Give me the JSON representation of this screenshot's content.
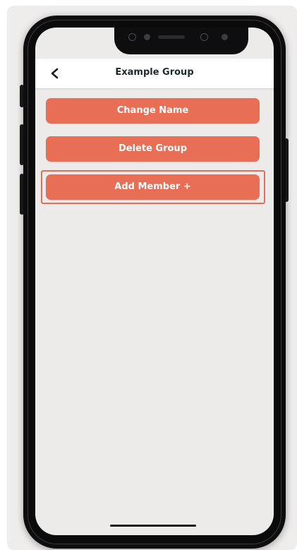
{
  "header": {
    "title": "Example Group",
    "back_icon": "chevron-left-icon"
  },
  "actions": [
    {
      "label": "Change Name"
    },
    {
      "label": "Delete Group"
    },
    {
      "label": "Add Member +"
    }
  ],
  "colors": {
    "accent": "#e86f55",
    "screen_background": "#ecebe9",
    "header_background": "#ffffff",
    "highlight_border": "#e07058"
  }
}
